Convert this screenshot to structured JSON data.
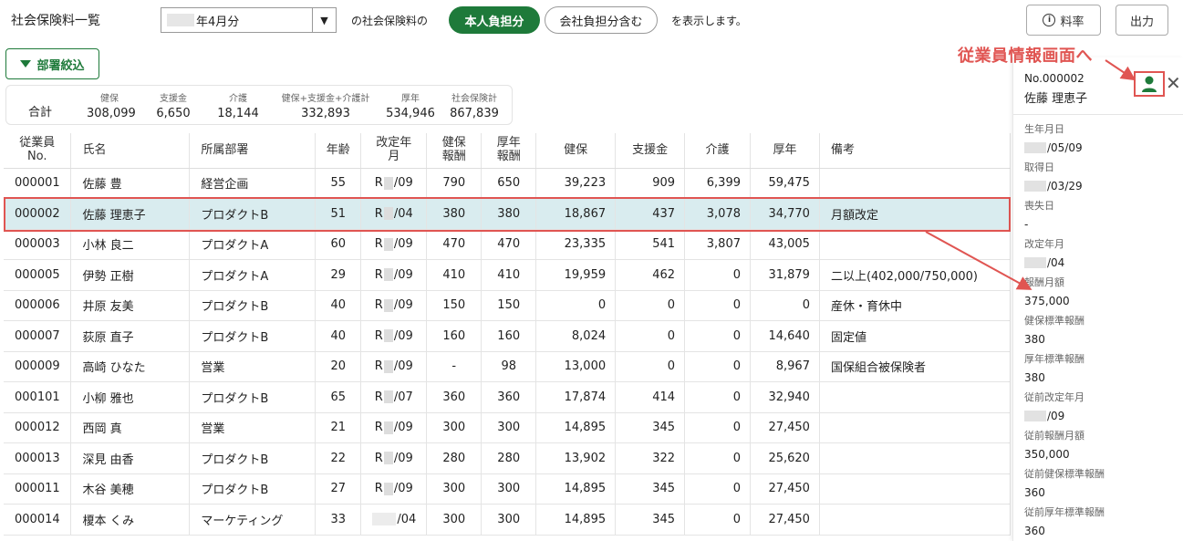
{
  "header": {
    "title": "社会保険料一覧",
    "month_value": "年4月分",
    "select_caret": "▼",
    "of_text": "の社会保険料の",
    "btn_employee": "本人負担分",
    "btn_company": "会社負担分含む",
    "display_text": "を表示します。",
    "btn_rate": "料率",
    "btn_output": "出力"
  },
  "filter": {
    "label": "部署絞込"
  },
  "totals": {
    "label": "合計",
    "items": [
      {
        "h": "健保",
        "v": "308,099"
      },
      {
        "h": "支援金",
        "v": "6,650"
      },
      {
        "h": "介護",
        "v": "18,144"
      },
      {
        "h": "健保+支援金+介護計",
        "v": "332,893"
      },
      {
        "h": "厚年",
        "v": "534,946"
      },
      {
        "h": "社会保険計",
        "v": "867,839"
      }
    ]
  },
  "table": {
    "headers": {
      "emp_no_1": "従業員",
      "emp_no_2": "No.",
      "name": "氏名",
      "dept": "所属部署",
      "age": "年齢",
      "rev_1": "改定年",
      "rev_2": "月",
      "kp_1": "健保",
      "kp_2": "報酬",
      "ko_1": "厚年",
      "ko_2": "報酬",
      "kenpo": "健保",
      "shien": "支援金",
      "kaigo": "介護",
      "kounen": "厚年",
      "biko": "備考"
    },
    "rows": [
      {
        "no": "000001",
        "name": "佐藤 豊",
        "dept": "経営企画",
        "age": "55",
        "rev_a": "R",
        "rev_b": "/09",
        "kp": "790",
        "ko": "650",
        "kenpo": "39,223",
        "shien": "909",
        "kaigo": "6,399",
        "kounen": "59,475",
        "biko": ""
      },
      {
        "no": "000002",
        "name": "佐藤 理恵子",
        "dept": "プロダクトB",
        "age": "51",
        "rev_a": "R",
        "rev_b": "/04",
        "kp": "380",
        "ko": "380",
        "kenpo": "18,867",
        "shien": "437",
        "kaigo": "3,078",
        "kounen": "34,770",
        "biko": "月額改定"
      },
      {
        "no": "000003",
        "name": "小林 良二",
        "dept": "プロダクトA",
        "age": "60",
        "rev_a": "R",
        "rev_b": "/09",
        "kp": "470",
        "ko": "470",
        "kenpo": "23,335",
        "shien": "541",
        "kaigo": "3,807",
        "kounen": "43,005",
        "biko": ""
      },
      {
        "no": "000005",
        "name": "伊勢 正樹",
        "dept": "プロダクトA",
        "age": "29",
        "rev_a": "R",
        "rev_b": "/09",
        "kp": "410",
        "ko": "410",
        "kenpo": "19,959",
        "shien": "462",
        "kaigo": "0",
        "kounen": "31,879",
        "biko": "二以上(402,000/750,000)"
      },
      {
        "no": "000006",
        "name": "井原 友美",
        "dept": "プロダクトB",
        "age": "40",
        "rev_a": "R",
        "rev_b": "/09",
        "kp": "150",
        "ko": "150",
        "kenpo": "0",
        "shien": "0",
        "kaigo": "0",
        "kounen": "0",
        "biko": "産休・育休中"
      },
      {
        "no": "000007",
        "name": "荻原 直子",
        "dept": "プロダクトB",
        "age": "40",
        "rev_a": "R",
        "rev_b": "/09",
        "kp": "160",
        "ko": "160",
        "kenpo": "8,024",
        "shien": "0",
        "kaigo": "0",
        "kounen": "14,640",
        "biko": "固定値"
      },
      {
        "no": "000009",
        "name": "高崎 ひなた",
        "dept": "営業",
        "age": "20",
        "rev_a": "R",
        "rev_b": "/09",
        "kp": "-",
        "ko": "98",
        "kenpo": "13,000",
        "shien": "0",
        "kaigo": "0",
        "kounen": "8,967",
        "biko": "国保組合被保険者"
      },
      {
        "no": "000101",
        "name": "小柳 雅也",
        "dept": "プロダクトB",
        "age": "65",
        "rev_a": "R",
        "rev_b": "/07",
        "kp": "360",
        "ko": "360",
        "kenpo": "17,874",
        "shien": "414",
        "kaigo": "0",
        "kounen": "32,940",
        "biko": ""
      },
      {
        "no": "000012",
        "name": "西岡 真",
        "dept": "営業",
        "age": "21",
        "rev_a": "R",
        "rev_b": "/09",
        "kp": "300",
        "ko": "300",
        "kenpo": "14,895",
        "shien": "345",
        "kaigo": "0",
        "kounen": "27,450",
        "biko": ""
      },
      {
        "no": "000013",
        "name": "深見 由香",
        "dept": "プロダクトB",
        "age": "22",
        "rev_a": "R",
        "rev_b": "/09",
        "kp": "280",
        "ko": "280",
        "kenpo": "13,902",
        "shien": "322",
        "kaigo": "0",
        "kounen": "25,620",
        "biko": ""
      },
      {
        "no": "000011",
        "name": "木谷 美穂",
        "dept": "プロダクトB",
        "age": "27",
        "rev_a": "R",
        "rev_b": "/09",
        "kp": "300",
        "ko": "300",
        "kenpo": "14,895",
        "shien": "345",
        "kaigo": "0",
        "kounen": "27,450",
        "biko": ""
      },
      {
        "no": "000014",
        "name": "榎本 くみ",
        "dept": "マーケティング",
        "age": "33",
        "rev_a": "",
        "rev_b": "/04",
        "kp": "300",
        "ko": "300",
        "kenpo": "14,895",
        "shien": "345",
        "kaigo": "0",
        "kounen": "27,450",
        "biko": ""
      }
    ]
  },
  "panel": {
    "no": "No.000002",
    "name": "佐藤 理恵子",
    "fields": [
      {
        "k": "生年月日",
        "v": "/05/09",
        "redacted": true
      },
      {
        "k": "取得日",
        "v": "/03/29",
        "redacted": true
      },
      {
        "k": "喪失日",
        "v": "-",
        "redacted": false
      },
      {
        "k": "改定年月",
        "v": "/04",
        "redacted": true
      },
      {
        "k": "報酬月額",
        "v": "375,000",
        "redacted": false
      },
      {
        "k": "健保標準報酬",
        "v": "380",
        "redacted": false
      },
      {
        "k": "厚年標準報酬",
        "v": "380",
        "redacted": false
      },
      {
        "k": "従前改定年月",
        "v": "/09",
        "redacted": true
      },
      {
        "k": "従前報酬月額",
        "v": "350,000",
        "redacted": false
      },
      {
        "k": "従前健保標準報酬",
        "v": "360",
        "redacted": false
      },
      {
        "k": "従前厚年標準報酬",
        "v": "360",
        "redacted": false
      }
    ],
    "close": "✕"
  },
  "annotation": {
    "text": "従業員情報画面へ",
    "color": "#e05552"
  },
  "colors": {
    "accent": "#1e7a3a",
    "selected_row": "#d9ecef",
    "highlight": "#e05552"
  },
  "icons": [
    "info-icon",
    "filter-icon",
    "user-icon",
    "close-icon",
    "chevron-down-icon"
  ]
}
